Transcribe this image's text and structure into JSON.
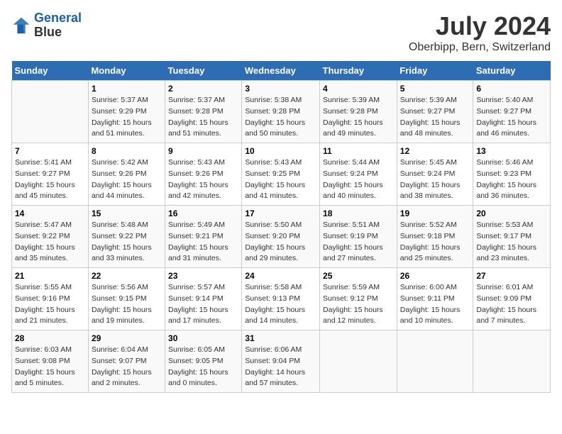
{
  "header": {
    "logo_line1": "General",
    "logo_line2": "Blue",
    "title": "July 2024",
    "subtitle": "Oberbipp, Bern, Switzerland"
  },
  "calendar": {
    "days_of_week": [
      "Sunday",
      "Monday",
      "Tuesday",
      "Wednesday",
      "Thursday",
      "Friday",
      "Saturday"
    ],
    "weeks": [
      [
        {
          "num": "",
          "info": ""
        },
        {
          "num": "1",
          "info": "Sunrise: 5:37 AM\nSunset: 9:29 PM\nDaylight: 15 hours\nand 51 minutes."
        },
        {
          "num": "2",
          "info": "Sunrise: 5:37 AM\nSunset: 9:28 PM\nDaylight: 15 hours\nand 51 minutes."
        },
        {
          "num": "3",
          "info": "Sunrise: 5:38 AM\nSunset: 9:28 PM\nDaylight: 15 hours\nand 50 minutes."
        },
        {
          "num": "4",
          "info": "Sunrise: 5:39 AM\nSunset: 9:28 PM\nDaylight: 15 hours\nand 49 minutes."
        },
        {
          "num": "5",
          "info": "Sunrise: 5:39 AM\nSunset: 9:27 PM\nDaylight: 15 hours\nand 48 minutes."
        },
        {
          "num": "6",
          "info": "Sunrise: 5:40 AM\nSunset: 9:27 PM\nDaylight: 15 hours\nand 46 minutes."
        }
      ],
      [
        {
          "num": "7",
          "info": "Sunrise: 5:41 AM\nSunset: 9:27 PM\nDaylight: 15 hours\nand 45 minutes."
        },
        {
          "num": "8",
          "info": "Sunrise: 5:42 AM\nSunset: 9:26 PM\nDaylight: 15 hours\nand 44 minutes."
        },
        {
          "num": "9",
          "info": "Sunrise: 5:43 AM\nSunset: 9:26 PM\nDaylight: 15 hours\nand 42 minutes."
        },
        {
          "num": "10",
          "info": "Sunrise: 5:43 AM\nSunset: 9:25 PM\nDaylight: 15 hours\nand 41 minutes."
        },
        {
          "num": "11",
          "info": "Sunrise: 5:44 AM\nSunset: 9:24 PM\nDaylight: 15 hours\nand 40 minutes."
        },
        {
          "num": "12",
          "info": "Sunrise: 5:45 AM\nSunset: 9:24 PM\nDaylight: 15 hours\nand 38 minutes."
        },
        {
          "num": "13",
          "info": "Sunrise: 5:46 AM\nSunset: 9:23 PM\nDaylight: 15 hours\nand 36 minutes."
        }
      ],
      [
        {
          "num": "14",
          "info": "Sunrise: 5:47 AM\nSunset: 9:22 PM\nDaylight: 15 hours\nand 35 minutes."
        },
        {
          "num": "15",
          "info": "Sunrise: 5:48 AM\nSunset: 9:22 PM\nDaylight: 15 hours\nand 33 minutes."
        },
        {
          "num": "16",
          "info": "Sunrise: 5:49 AM\nSunset: 9:21 PM\nDaylight: 15 hours\nand 31 minutes."
        },
        {
          "num": "17",
          "info": "Sunrise: 5:50 AM\nSunset: 9:20 PM\nDaylight: 15 hours\nand 29 minutes."
        },
        {
          "num": "18",
          "info": "Sunrise: 5:51 AM\nSunset: 9:19 PM\nDaylight: 15 hours\nand 27 minutes."
        },
        {
          "num": "19",
          "info": "Sunrise: 5:52 AM\nSunset: 9:18 PM\nDaylight: 15 hours\nand 25 minutes."
        },
        {
          "num": "20",
          "info": "Sunrise: 5:53 AM\nSunset: 9:17 PM\nDaylight: 15 hours\nand 23 minutes."
        }
      ],
      [
        {
          "num": "21",
          "info": "Sunrise: 5:55 AM\nSunset: 9:16 PM\nDaylight: 15 hours\nand 21 minutes."
        },
        {
          "num": "22",
          "info": "Sunrise: 5:56 AM\nSunset: 9:15 PM\nDaylight: 15 hours\nand 19 minutes."
        },
        {
          "num": "23",
          "info": "Sunrise: 5:57 AM\nSunset: 9:14 PM\nDaylight: 15 hours\nand 17 minutes."
        },
        {
          "num": "24",
          "info": "Sunrise: 5:58 AM\nSunset: 9:13 PM\nDaylight: 15 hours\nand 14 minutes."
        },
        {
          "num": "25",
          "info": "Sunrise: 5:59 AM\nSunset: 9:12 PM\nDaylight: 15 hours\nand 12 minutes."
        },
        {
          "num": "26",
          "info": "Sunrise: 6:00 AM\nSunset: 9:11 PM\nDaylight: 15 hours\nand 10 minutes."
        },
        {
          "num": "27",
          "info": "Sunrise: 6:01 AM\nSunset: 9:09 PM\nDaylight: 15 hours\nand 7 minutes."
        }
      ],
      [
        {
          "num": "28",
          "info": "Sunrise: 6:03 AM\nSunset: 9:08 PM\nDaylight: 15 hours\nand 5 minutes."
        },
        {
          "num": "29",
          "info": "Sunrise: 6:04 AM\nSunset: 9:07 PM\nDaylight: 15 hours\nand 2 minutes."
        },
        {
          "num": "30",
          "info": "Sunrise: 6:05 AM\nSunset: 9:05 PM\nDaylight: 15 hours\nand 0 minutes."
        },
        {
          "num": "31",
          "info": "Sunrise: 6:06 AM\nSunset: 9:04 PM\nDaylight: 14 hours\nand 57 minutes."
        },
        {
          "num": "",
          "info": ""
        },
        {
          "num": "",
          "info": ""
        },
        {
          "num": "",
          "info": ""
        }
      ]
    ]
  }
}
